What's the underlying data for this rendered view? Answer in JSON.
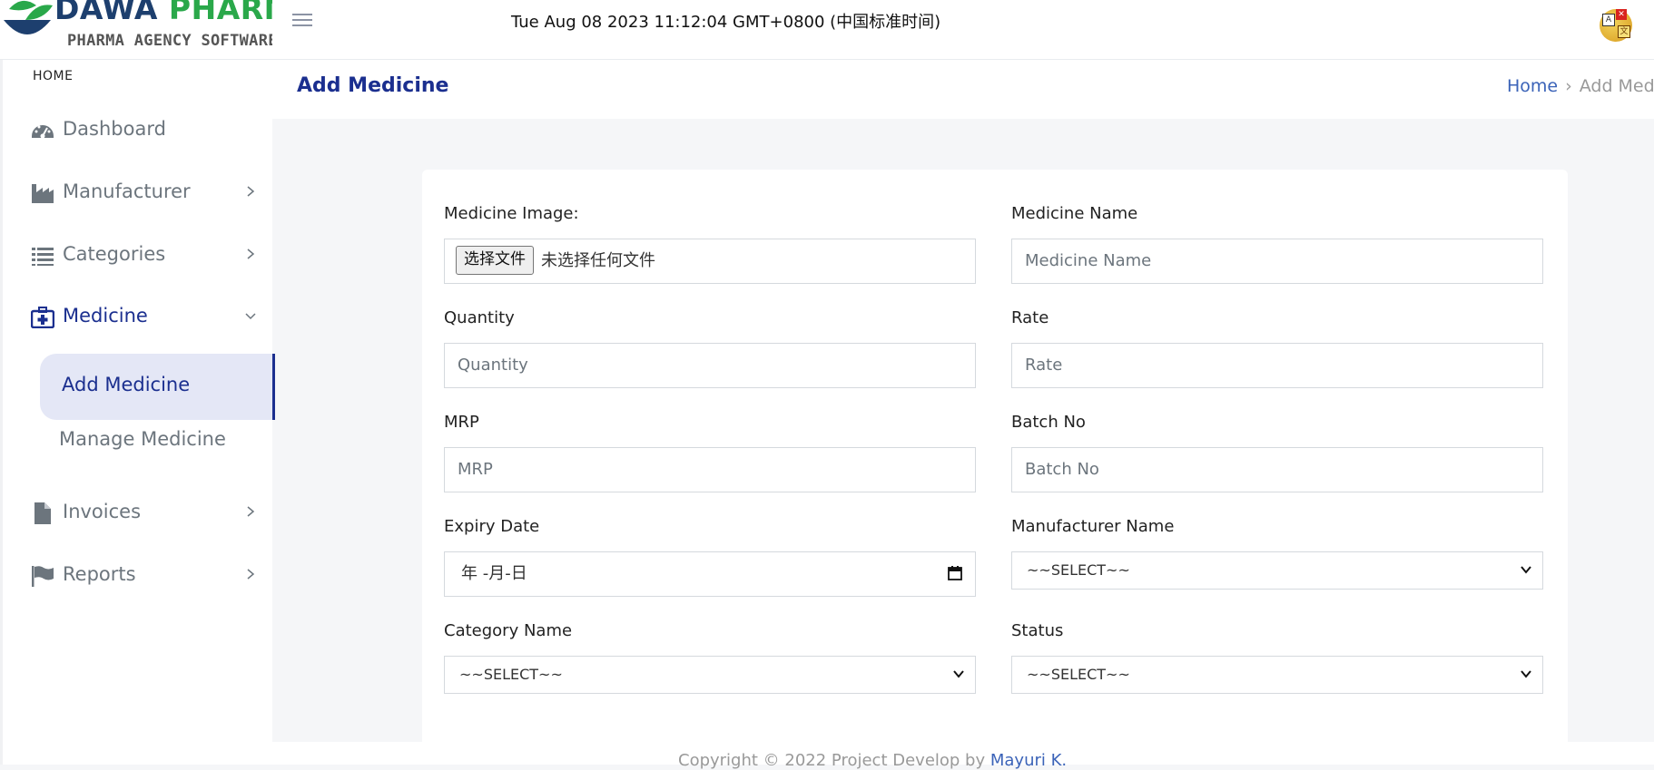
{
  "header": {
    "brand_word1": "DAWA",
    "brand_word2": "PHARMA",
    "brand_sub": "PHARMA AGENCY SOFTWARE",
    "datetime": "Tue Aug 08 2023 11:12:04 GMT+0800 (中国标准时间)"
  },
  "sidebar": {
    "section": "HOME",
    "items": [
      {
        "label": "Dashboard",
        "icon": "dashboard-gauge-icon"
      },
      {
        "label": "Manufacturer",
        "icon": "factory-icon"
      },
      {
        "label": "Categories",
        "icon": "list-icon"
      },
      {
        "label": "Medicine",
        "icon": "medkit-icon"
      },
      {
        "label": "Invoices",
        "icon": "file-icon"
      },
      {
        "label": "Reports",
        "icon": "flag-icon"
      }
    ],
    "sub_items": [
      "Add Medicine",
      "Manage Medicine"
    ]
  },
  "page": {
    "title": "Add Medicine",
    "breadcrumb_home": "Home",
    "breadcrumb_current": "Add Medicine"
  },
  "form": {
    "image_label": "Medicine Image:",
    "file_button": "选择文件",
    "file_status": "未选择任何文件",
    "name_label": "Medicine Name",
    "name_placeholder": "Medicine Name",
    "quantity_label": "Quantity",
    "quantity_placeholder": "Quantity",
    "rate_label": "Rate",
    "rate_placeholder": "Rate",
    "mrp_label": "MRP",
    "mrp_placeholder": "MRP",
    "batch_label": "Batch No",
    "batch_placeholder": "Batch No",
    "expiry_label": "Expiry Date",
    "expiry_value": "年 -月-日",
    "manufacturer_label": "Manufacturer Name",
    "manufacturer_value": "~~SELECT~~",
    "category_label": "Category Name",
    "category_value": "~~SELECT~~",
    "status_label": "Status",
    "status_value": "~~SELECT~~"
  },
  "footer": {
    "text": "Copyright © 2022 Project Develop by ",
    "author": "Mayuri K."
  },
  "colors": {
    "accent": "#1b2f8f",
    "brand_green": "#2aa84a",
    "brand_navy": "#1d3f6e"
  }
}
